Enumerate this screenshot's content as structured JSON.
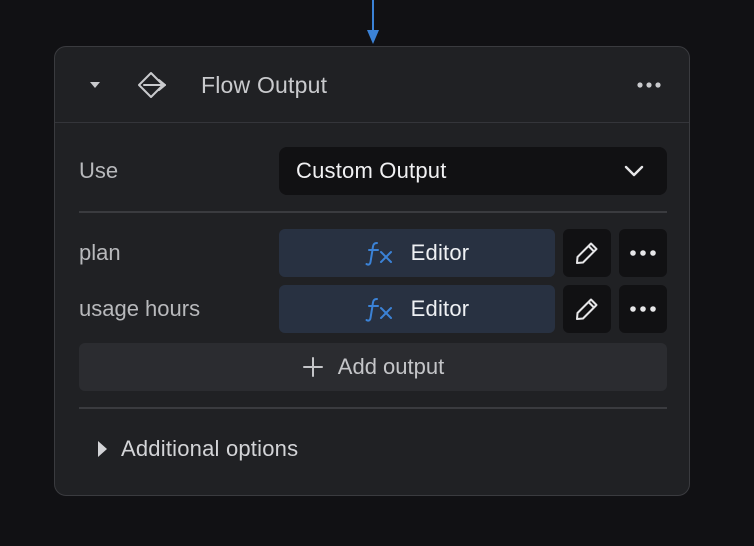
{
  "node": {
    "title": "Flow Output",
    "collapse_icon": "caret-down-icon",
    "type_icon": "flow-output-icon",
    "menu_icon": "more-horizontal-icon"
  },
  "use": {
    "label": "Use",
    "selected": "Custom Output"
  },
  "outputs": [
    {
      "name": "plan",
      "editor_label": "Editor"
    },
    {
      "name": "usage hours",
      "editor_label": "Editor"
    }
  ],
  "add_output": {
    "label": "Add output",
    "icon": "plus-icon"
  },
  "additional_options": {
    "label": "Additional options",
    "icon": "caret-right-icon"
  },
  "colors": {
    "background": "#111114",
    "card": "#202124",
    "accent": "#3b82d6",
    "editor_bg": "#283141"
  }
}
